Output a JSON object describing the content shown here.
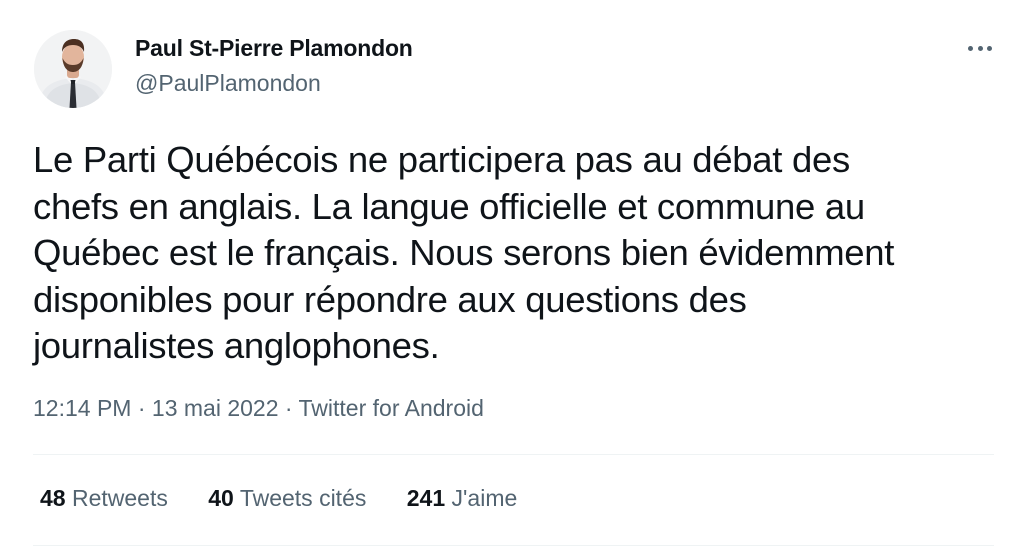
{
  "author": {
    "name": "Paul St-Pierre Plamondon",
    "handle": "@PaulPlamondon"
  },
  "tweet": {
    "lines": [
      "Le Parti Québécois ne participera pas au débat des",
      "chefs en anglais. La langue officielle et commune au",
      "Québec est le français. Nous serons bien évidemment",
      "disponibles pour répondre aux questions des",
      "journalistes anglophones."
    ]
  },
  "meta": {
    "time": "12:14 PM",
    "separator": " · ",
    "date": "13 mai 2022",
    "source": "Twitter for Android"
  },
  "stats": {
    "retweets": {
      "count": "48",
      "label": " Retweets"
    },
    "quotes": {
      "count": "40",
      "label": " Tweets cités"
    },
    "likes": {
      "count": "241",
      "label": " J'aime"
    }
  },
  "icons": {
    "more": "more-horizontal-icon",
    "avatar": "profile-photo"
  },
  "colors": {
    "text": "#0f1419",
    "secondary": "#536471",
    "divider": "#eff3f4"
  }
}
